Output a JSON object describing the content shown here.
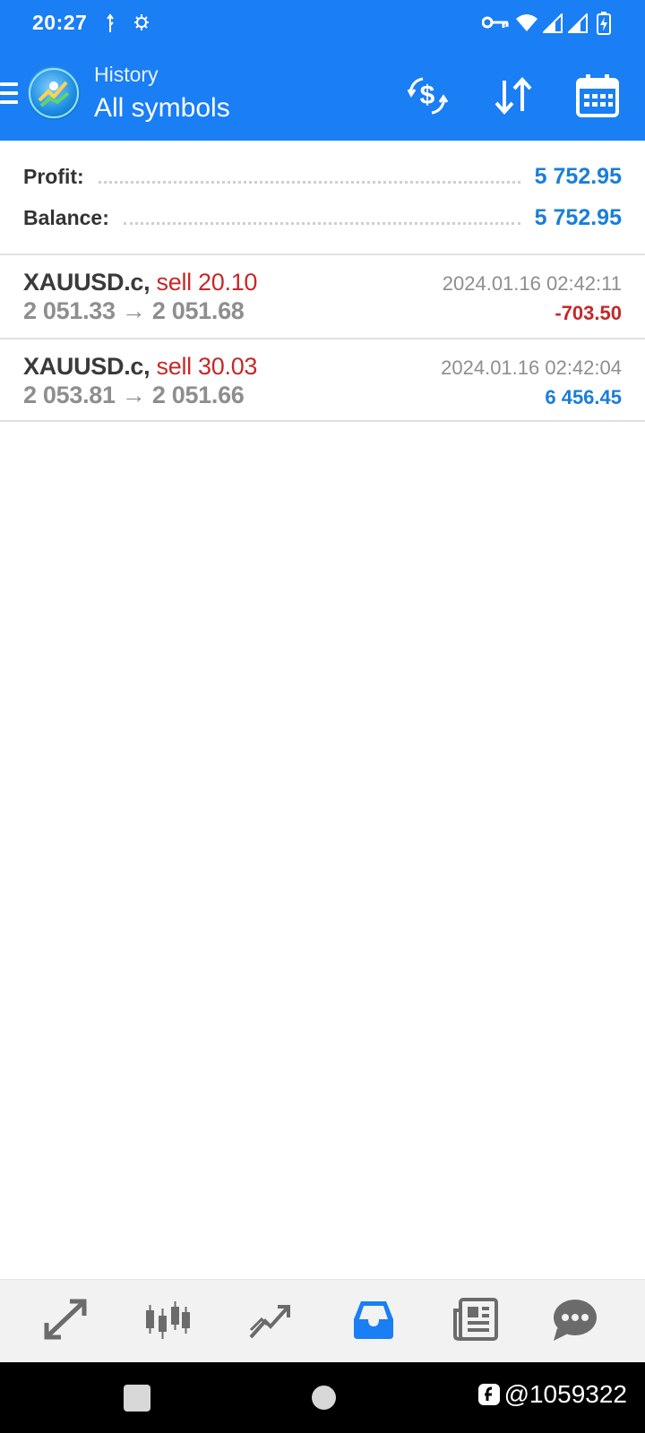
{
  "status_bar": {
    "time": "20:27",
    "icons": [
      "key-icon",
      "wifi-icon",
      "signal-icon",
      "signal-icon",
      "battery-charging-icon"
    ]
  },
  "app_bar": {
    "subtitle": "History",
    "title": "All symbols",
    "actions": [
      "currency-exchange-icon",
      "sort-icon",
      "calendar-icon"
    ]
  },
  "summary": {
    "profit_label": "Profit:",
    "profit_value": "5 752.95",
    "balance_label": "Balance:",
    "balance_value": "5 752.95"
  },
  "trades": [
    {
      "symbol": "XAUUSD.c,",
      "side_volume": "sell 20.10",
      "open_price": "2 051.33",
      "arrow": "→",
      "close_price": "2 051.68",
      "time": "2024.01.16 02:42:11",
      "profit": "-703.50"
    },
    {
      "symbol": "XAUUSD.c,",
      "side_volume": "sell 30.03",
      "open_price": "2 053.81",
      "arrow": "→",
      "close_price": "2 051.66",
      "time": "2024.01.16 02:42:04",
      "profit": "6 456.45"
    }
  ],
  "bottom_nav": {
    "items": [
      "quotes-icon",
      "chart-icon",
      "trade-icon",
      "history-icon",
      "news-icon",
      "chat-icon"
    ],
    "active": "history-icon"
  },
  "watermark": {
    "text": "@1059322"
  },
  "colors": {
    "accent": "#1a7ef4",
    "positive": "#1a7ed8",
    "negative": "#c62828"
  }
}
